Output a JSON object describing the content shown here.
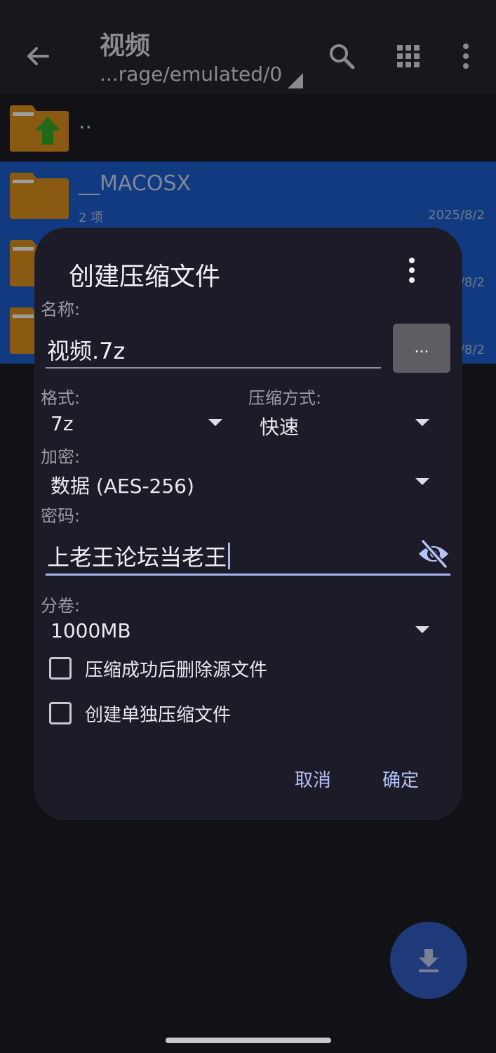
{
  "appbar": {
    "title": "视频",
    "path": "...rage/emulated/0"
  },
  "files": [
    {
      "name": "..",
      "meta": "",
      "date": "",
      "selected": false,
      "type": "parent"
    },
    {
      "name": "__MACOSX",
      "meta": "2 项",
      "date": "2025/8/2",
      "selected": true,
      "type": "folder"
    },
    {
      "name": "",
      "meta": "",
      "date": "/8/2",
      "selected": true,
      "type": "folder"
    },
    {
      "name": "",
      "meta": "",
      "date": "/8/2",
      "selected": true,
      "type": "folder"
    }
  ],
  "dialog": {
    "title": "创建压缩文件",
    "name_label": "名称:",
    "name_value": "视频.7z",
    "browse_label": "...",
    "format_label": "格式:",
    "format_value": "7z",
    "method_label": "压缩方式:",
    "method_value": "快速",
    "encrypt_label": "加密:",
    "encrypt_value": "数据 (AES-256)",
    "password_label": "密码:",
    "password_value": "上老王论坛当老王",
    "split_label": "分卷:",
    "split_value": "1000MB",
    "checkbox_delete_source": "压缩成功后删除源文件",
    "checkbox_separate": "创建单独压缩文件",
    "cancel_label": "取消",
    "ok_label": "确定"
  },
  "colors": {
    "selection": "#123a80",
    "accent": "#aab4f0",
    "dialog_bg": "#1c1c28",
    "fab": "#1e3a7a"
  }
}
